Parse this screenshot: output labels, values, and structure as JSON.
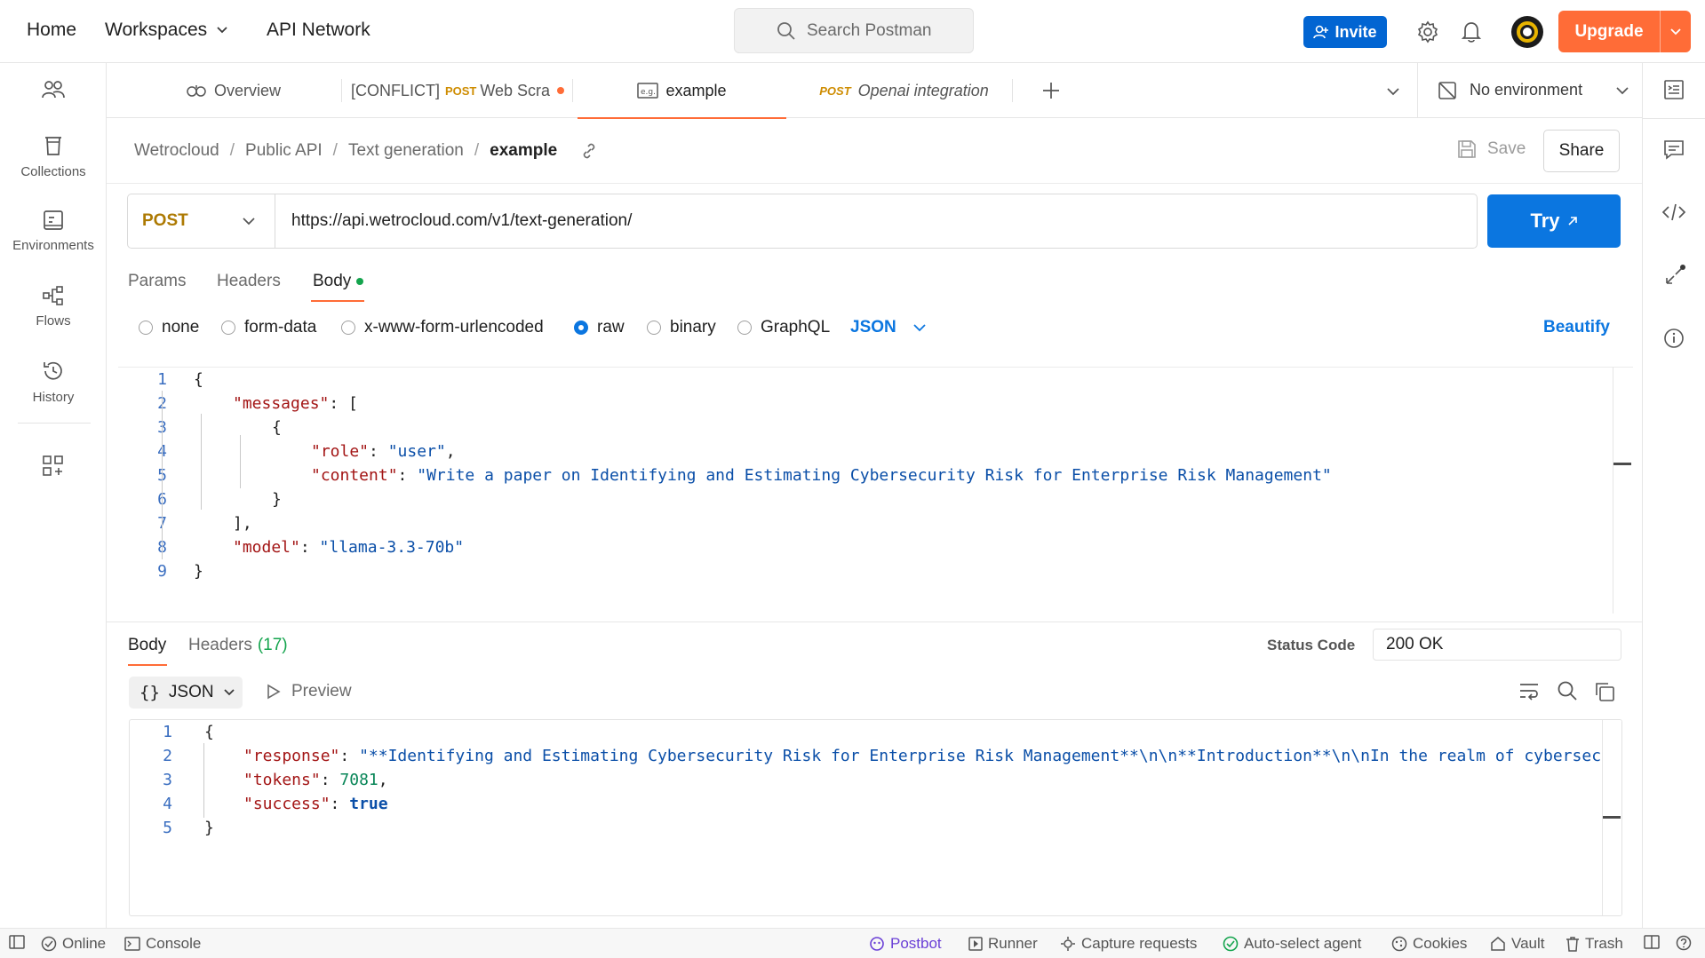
{
  "topbar": {
    "nav": [
      "Home",
      "Workspaces",
      "API Network"
    ],
    "search_placeholder": "Search Postman",
    "invite_label": "Invite",
    "upgrade_label": "Upgrade"
  },
  "sidebar": {
    "items": [
      {
        "label": "Collections"
      },
      {
        "label": "Environments"
      },
      {
        "label": "Flows"
      },
      {
        "label": "History"
      }
    ]
  },
  "tabs": [
    {
      "label": "Overview"
    },
    {
      "prefix": "[CONFLICT]",
      "method": "POST",
      "label": "Web Scra"
    },
    {
      "label": "example"
    },
    {
      "method": "POST",
      "label": "Openai integration"
    }
  ],
  "environment": "No environment",
  "breadcrumb": [
    "Wetrocloud",
    "Public API",
    "Text generation",
    "example"
  ],
  "actions": {
    "save": "Save",
    "share": "Share"
  },
  "request": {
    "method": "POST",
    "url": "https://api.wetrocloud.com/v1/text-generation/",
    "try_label": "Try",
    "subtabs": [
      "Params",
      "Headers",
      "Body"
    ],
    "body_types": [
      "none",
      "form-data",
      "x-www-form-urlencoded",
      "raw",
      "binary",
      "GraphQL"
    ],
    "selected_body_type": "raw",
    "language": "JSON",
    "beautify": "Beautify",
    "line_numbers": [
      "1",
      "2",
      "3",
      "4",
      "5",
      "6",
      "7",
      "8",
      "9"
    ],
    "body_lines": {
      "l1": "{",
      "l2_key": "\"messages\"",
      "l2_rest": ": [",
      "l3": "{",
      "l4_key": "\"role\"",
      "l4_colon": ": ",
      "l4_val": "\"user\"",
      "l4_end": ",",
      "l5_key": "\"content\"",
      "l5_colon": ": ",
      "l5_val": "\"Write a paper on Identifying and Estimating Cybersecurity Risk for Enterprise Risk Management\"",
      "l6": "}",
      "l7": "],",
      "l8_key": "\"model\"",
      "l8_colon": ": ",
      "l8_val": "\"llama-3.3-70b\"",
      "l9": "}"
    }
  },
  "response": {
    "tabs": {
      "body": "Body",
      "headers": "Headers",
      "headers_count": "(17)"
    },
    "status_label": "Status Code",
    "status_value": "200 OK",
    "format": "JSON",
    "preview": "Preview",
    "line_numbers": [
      "1",
      "2",
      "3",
      "4",
      "5"
    ],
    "lines": {
      "l1": "{",
      "l2_key": "\"response\"",
      "l2_colon": ": ",
      "l2_val": "\"**Identifying and Estimating Cybersecurity Risk for Enterprise Risk Management**\\n\\n**Introduction**\\n\\nIn the realm of cybersecurity",
      "l3_key": "\"tokens\"",
      "l3_colon": ": ",
      "l3_val": "7081",
      "l3_end": ",",
      "l4_key": "\"success\"",
      "l4_colon": ": ",
      "l4_val": "true",
      "l5": "}"
    }
  },
  "footer": {
    "online": "Online",
    "console": "Console",
    "postbot": "Postbot",
    "runner": "Runner",
    "capture": "Capture requests",
    "agent": "Auto-select agent",
    "cookies": "Cookies",
    "vault": "Vault",
    "trash": "Trash"
  },
  "colors": {
    "accent_orange": "#ff6c37",
    "invite_blue": "#0265d2",
    "try_blue": "#0b76e0",
    "method_post": "#ad7a03",
    "status_dot_green": "#14a44d",
    "tab_underline": "#ff6c37"
  }
}
